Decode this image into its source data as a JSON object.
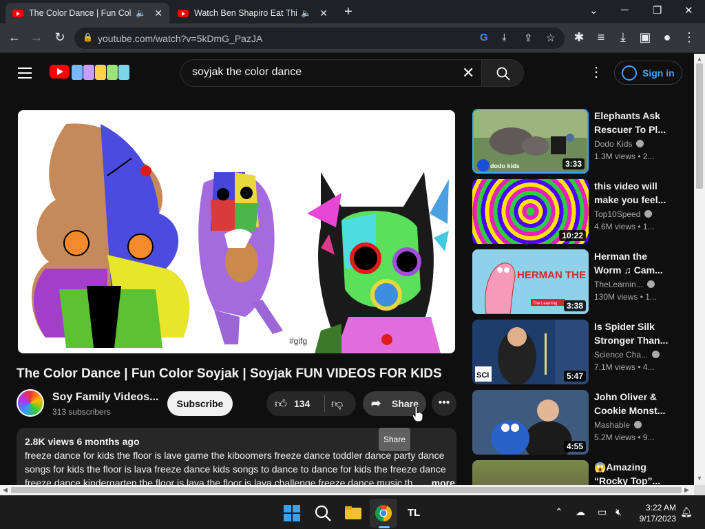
{
  "browser": {
    "tabs": [
      {
        "title": "The Color Dance | Fun Color Soyjak | Soyjak FUN VIDEOS FOR KIDS",
        "active": true
      },
      {
        "title": "Watch Ben Shapiro Eat This Insane...",
        "active": false
      }
    ],
    "url": "youtube.com/watch?v=5kDmG_PazJA"
  },
  "masthead": {
    "search_value": "soyjak the color dance",
    "signin_label": "Sign in"
  },
  "video": {
    "overlay_tag": "#gifg",
    "title": "The Color Dance | Fun Color Soyjak | Soyjak FUN VIDEOS FOR KIDS",
    "channel_name": "Soy Family Videos...",
    "subscribers": "313 subscribers",
    "subscribe_label": "Subscribe",
    "like_count": "134",
    "share_label": "Share",
    "tooltip": "Share",
    "views_date": "2.8K views  6 months ago",
    "description": "freeze dance for kids the floor is lave game the kiboomers freeze dance toddler dance party dance songs for kids the floor is lava freeze dance kids songs to dance to dance for kids the freeze dance freeze dance kindergarten the floor is lava the floor is lava challenge freeze dance music th",
    "more_label": "...more"
  },
  "recommendations": [
    {
      "title": "Elephants Ask Rescuer To Pl...",
      "channel": "Dodo Kids",
      "views": "1.3M views  • 2...",
      "duration": "3:33",
      "verified": true
    },
    {
      "title": "this video will make you feel...",
      "channel": "Top10Speed",
      "views": "4.6M views  • 1...",
      "duration": "10:22",
      "verified": true
    },
    {
      "title": "Herman the Worm ♫ Cam...",
      "channel": "TheLearnin...",
      "views": "130M views  • 1...",
      "duration": "3:38",
      "verified": true
    },
    {
      "title": "Is Spider Silk Stronger Than...",
      "channel": "Science Cha...",
      "views": "7.1M views  • 4...",
      "duration": "5:47",
      "verified": true
    },
    {
      "title": "John Oliver & Cookie Monst...",
      "channel": "Mashable",
      "views": "5.2M views  • 9...",
      "duration": "4:55",
      "verified": true
    },
    {
      "title": "😱Amazing “Rocky Top”...",
      "channel": "",
      "views": "",
      "duration": "",
      "verified": false
    }
  ],
  "thumb_texts": {
    "herman": "HERMAN THE WORM",
    "dodo": "dodo kids",
    "learning": "The Learning",
    "sci": "SCI"
  },
  "taskbar": {
    "time": "3:22 AM",
    "date": "9/17/2023",
    "tl_label": "TL"
  }
}
